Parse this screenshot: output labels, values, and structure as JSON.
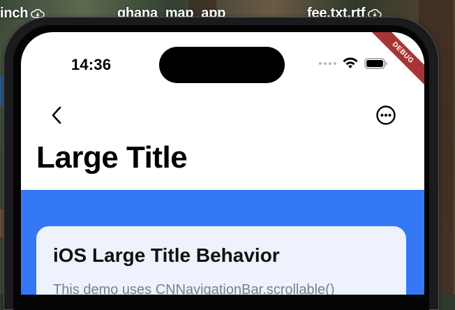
{
  "desktop": {
    "labels": [
      "inch",
      "ghana_map_app",
      "fee.txt.rtf"
    ]
  },
  "status_bar": {
    "time": "14:36",
    "icons": [
      "cellular-signal-icon",
      "wifi-icon",
      "battery-icon"
    ]
  },
  "debug_banner": "DEBUG",
  "nav_bar": {
    "back_icon": "chevron-left-icon",
    "more_icon": "ellipsis-circle-icon",
    "title": "Large Title"
  },
  "card": {
    "title": "iOS Large Title Behavior",
    "body": "This demo uses CNNavigationBar.scrollable()"
  },
  "colors": {
    "accent": "#3478f6",
    "card_bg": "#edf2fc",
    "debug": "#a73535"
  }
}
